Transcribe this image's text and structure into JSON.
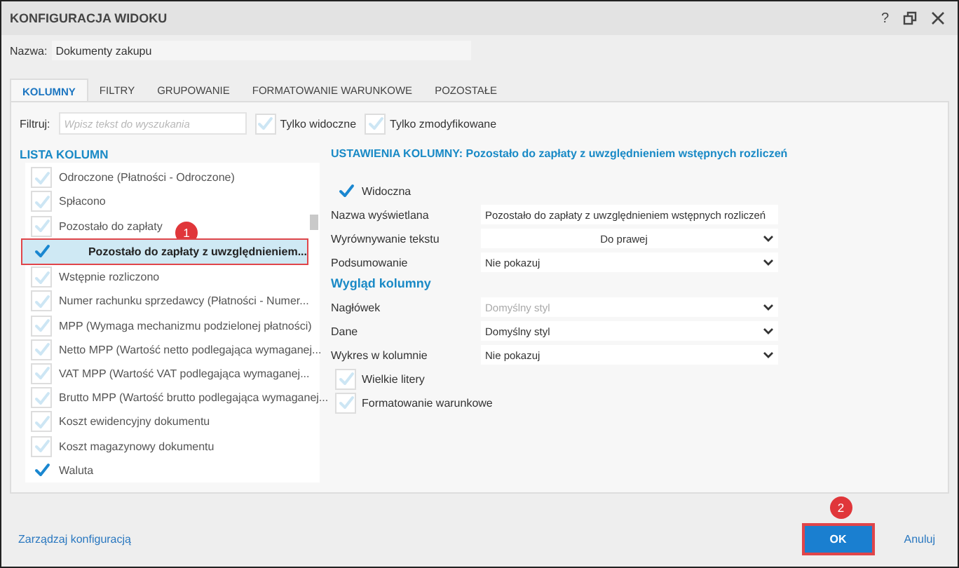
{
  "window": {
    "title": "KONFIGURACJA WIDOKU",
    "controls": [
      "?"
    ]
  },
  "name_field": {
    "label": "Nazwa:",
    "value": "Dokumenty zakupu"
  },
  "tabs": [
    {
      "label": "KOLUMNY",
      "selected": true
    },
    {
      "label": "FILTRY",
      "selected": false
    },
    {
      "label": "GRUPOWANIE",
      "selected": false
    },
    {
      "label": "FORMATOWANIE WARUNKOWE",
      "selected": false
    },
    {
      "label": "POZOSTAŁE",
      "selected": false
    }
  ],
  "filter": {
    "label": "Filtruj:",
    "placeholder": "Wpisz tekst do wyszukania",
    "options": [
      {
        "label": "Tylko widoczne",
        "checked": false
      },
      {
        "label": "Tylko zmodyfikowane",
        "checked": false
      }
    ]
  },
  "column_list": {
    "title": "LISTA KOLUMN",
    "items": [
      {
        "label": "Odroczone (Płatności - Odroczone)",
        "checked": false,
        "selected": false
      },
      {
        "label": "Spłacono",
        "checked": false,
        "selected": false
      },
      {
        "label": "Pozostało do zapłaty",
        "checked": false,
        "selected": false
      },
      {
        "label": "Pozostało do zapłaty z uwzględnieniem...",
        "checked": true,
        "selected": true,
        "marker": "1"
      },
      {
        "label": "Wstępnie rozliczono",
        "checked": false,
        "selected": false
      },
      {
        "label": "Numer rachunku sprzedawcy (Płatności - Numer...",
        "checked": false,
        "selected": false
      },
      {
        "label": "MPP (Wymaga mechanizmu podzielonej płatności)",
        "checked": false,
        "selected": false
      },
      {
        "label": "Netto MPP (Wartość netto podlegająca wymaganej...",
        "checked": false,
        "selected": false
      },
      {
        "label": "VAT MPP (Wartość VAT podlegająca wymaganej...",
        "checked": false,
        "selected": false
      },
      {
        "label": "Brutto MPP (Wartość brutto podlegająca wymaganej...",
        "checked": false,
        "selected": false
      },
      {
        "label": "Koszt ewidencyjny dokumentu",
        "checked": false,
        "selected": false
      },
      {
        "label": "Koszt magazynowy dokumentu",
        "checked": false,
        "selected": false
      },
      {
        "label": "Waluta",
        "checked": true,
        "selected": false
      }
    ]
  },
  "settings": {
    "title": "USTAWIENIA KOLUMNY: Pozostało do zapłaty z uwzględnieniem wstępnych rozliczeń",
    "rows": [
      {
        "kind": "checkbox",
        "label": "Widoczna",
        "checked": true
      },
      {
        "kind": "text",
        "label": "Nazwa wyświetlana",
        "value": "Pozostało do zapłaty z uwzględnieniem wstępnych rozliczeń"
      },
      {
        "kind": "select",
        "label": "Wyrównywanie tekstu",
        "value": "Do prawej",
        "centered": true,
        "disabled": false
      },
      {
        "kind": "select",
        "label": "Podsumowanie",
        "value": "Nie pokazuj",
        "centered": false,
        "disabled": false
      },
      {
        "kind": "heading",
        "label": "Wygląd kolumny"
      },
      {
        "kind": "select",
        "label": "Nagłówek",
        "value": "Domyślny styl",
        "centered": false,
        "disabled": true
      },
      {
        "kind": "select",
        "label": "Dane",
        "value": "Domyślny styl",
        "centered": false,
        "disabled": false
      },
      {
        "kind": "select",
        "label": "Wykres w kolumnie",
        "value": "Nie pokazuj",
        "centered": false,
        "disabled": false
      },
      {
        "kind": "checkbox",
        "label": "Wielkie litery",
        "checked": false
      },
      {
        "kind": "checkbox",
        "label": "Formatowanie warunkowe",
        "checked": false
      }
    ]
  },
  "footer": {
    "link": "Zarządzaj konfiguracją",
    "ok": {
      "label": "OK",
      "marker": "2"
    },
    "cancel": "Anuluj"
  }
}
